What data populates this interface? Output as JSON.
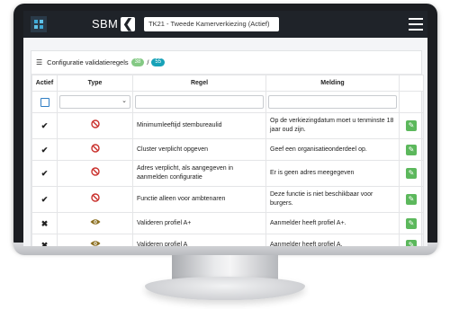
{
  "header": {
    "brand": "SBM",
    "back_symbol": "❮",
    "election_label": "TK21 - Tweede Kamerverkiezing (Actief)"
  },
  "card": {
    "title": "Configuratie validatieregels",
    "badge_active": "38",
    "separator": "/",
    "badge_total": "55"
  },
  "table": {
    "columns": [
      "Actief",
      "Type",
      "Regel",
      "Melding",
      ""
    ],
    "rows": [
      {
        "active": "✔",
        "type_icon": "ban-icon",
        "rule": "Minimumleeftijd stembureaulid",
        "message": "Op de verkiezingdatum moet u tenminste 18 jaar oud zijn."
      },
      {
        "active": "✔",
        "type_icon": "ban-icon",
        "rule": "Cluster verplicht opgeven",
        "message": "Geef een organisatieonderdeel op."
      },
      {
        "active": "✔",
        "type_icon": "ban-icon",
        "rule": "Adres verplicht, als aangegeven in aanmelden configuratie",
        "message": "Er is geen adres meegegeven"
      },
      {
        "active": "✔",
        "type_icon": "ban-icon",
        "rule": "Functie alleen voor ambtenaren",
        "message": "Deze functie is niet beschikbaar voor burgers."
      },
      {
        "active": "✖",
        "type_icon": "eye-icon",
        "rule": "Valideren profiel A+",
        "message": "Aanmelder heeft profiel A+."
      },
      {
        "active": "✖",
        "type_icon": "eye-icon",
        "rule": "Valideren profiel A",
        "message": "Aanmelder heeft profiel A."
      }
    ]
  },
  "colors": {
    "topbar": "#1f2329",
    "ban": "#c9302c",
    "eye": "#8a6d1e",
    "edit": "#5cb85c"
  }
}
